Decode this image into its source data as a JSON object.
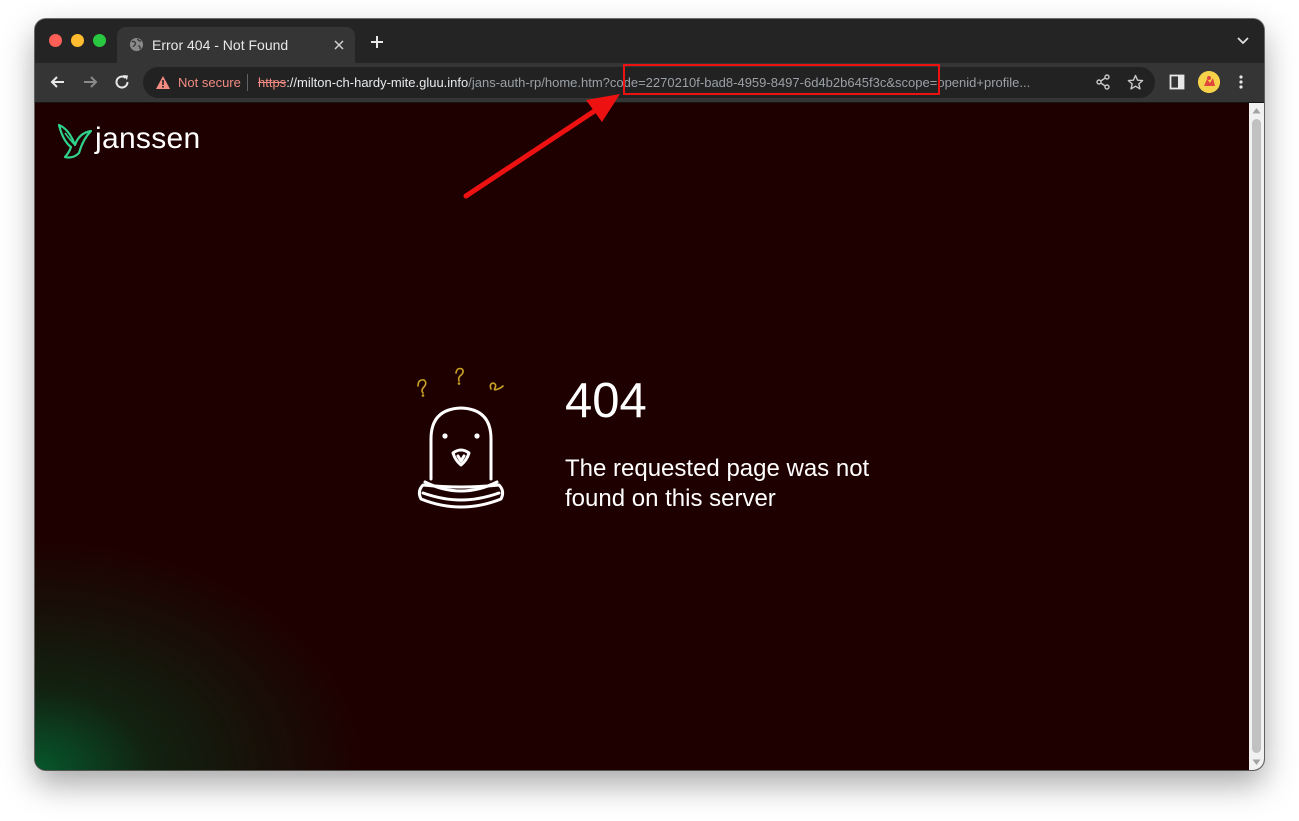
{
  "browser": {
    "tab_title": "Error 404 - Not Found",
    "security_label": "Not secure",
    "url_scheme": "https",
    "url_host_and_path_prefix": "://milton-ch-hardy-mite.gluu.info",
    "url_path": "/jans-auth-rp/home.htm?",
    "url_query": "code=2270210f-bad8-4959-8497-6d4b2b645f3c&scope=openid+profile..."
  },
  "icons": {
    "tab_favicon": "globe-icon",
    "tab_close": "close-icon",
    "new_tab": "plus-icon",
    "tab_list": "chevron-down-icon",
    "back": "arrow-left-icon",
    "forward": "arrow-right-icon",
    "reload": "reload-icon",
    "security": "warning-triangle-icon",
    "share": "share-icon",
    "bookmark": "star-icon",
    "side_panel": "side-panel-icon",
    "profile": "avatar",
    "menu": "kebab-menu-icon"
  },
  "page": {
    "logo_text": "janssen",
    "error_code": "404",
    "error_message": "The requested page was not found on this server"
  },
  "colors": {
    "page_background": "#1e0000",
    "accent_green": "#2fd38a",
    "not_secure_red": "#f28b82",
    "annotation_red": "#ee1111",
    "question_marks": "#c9a227"
  }
}
